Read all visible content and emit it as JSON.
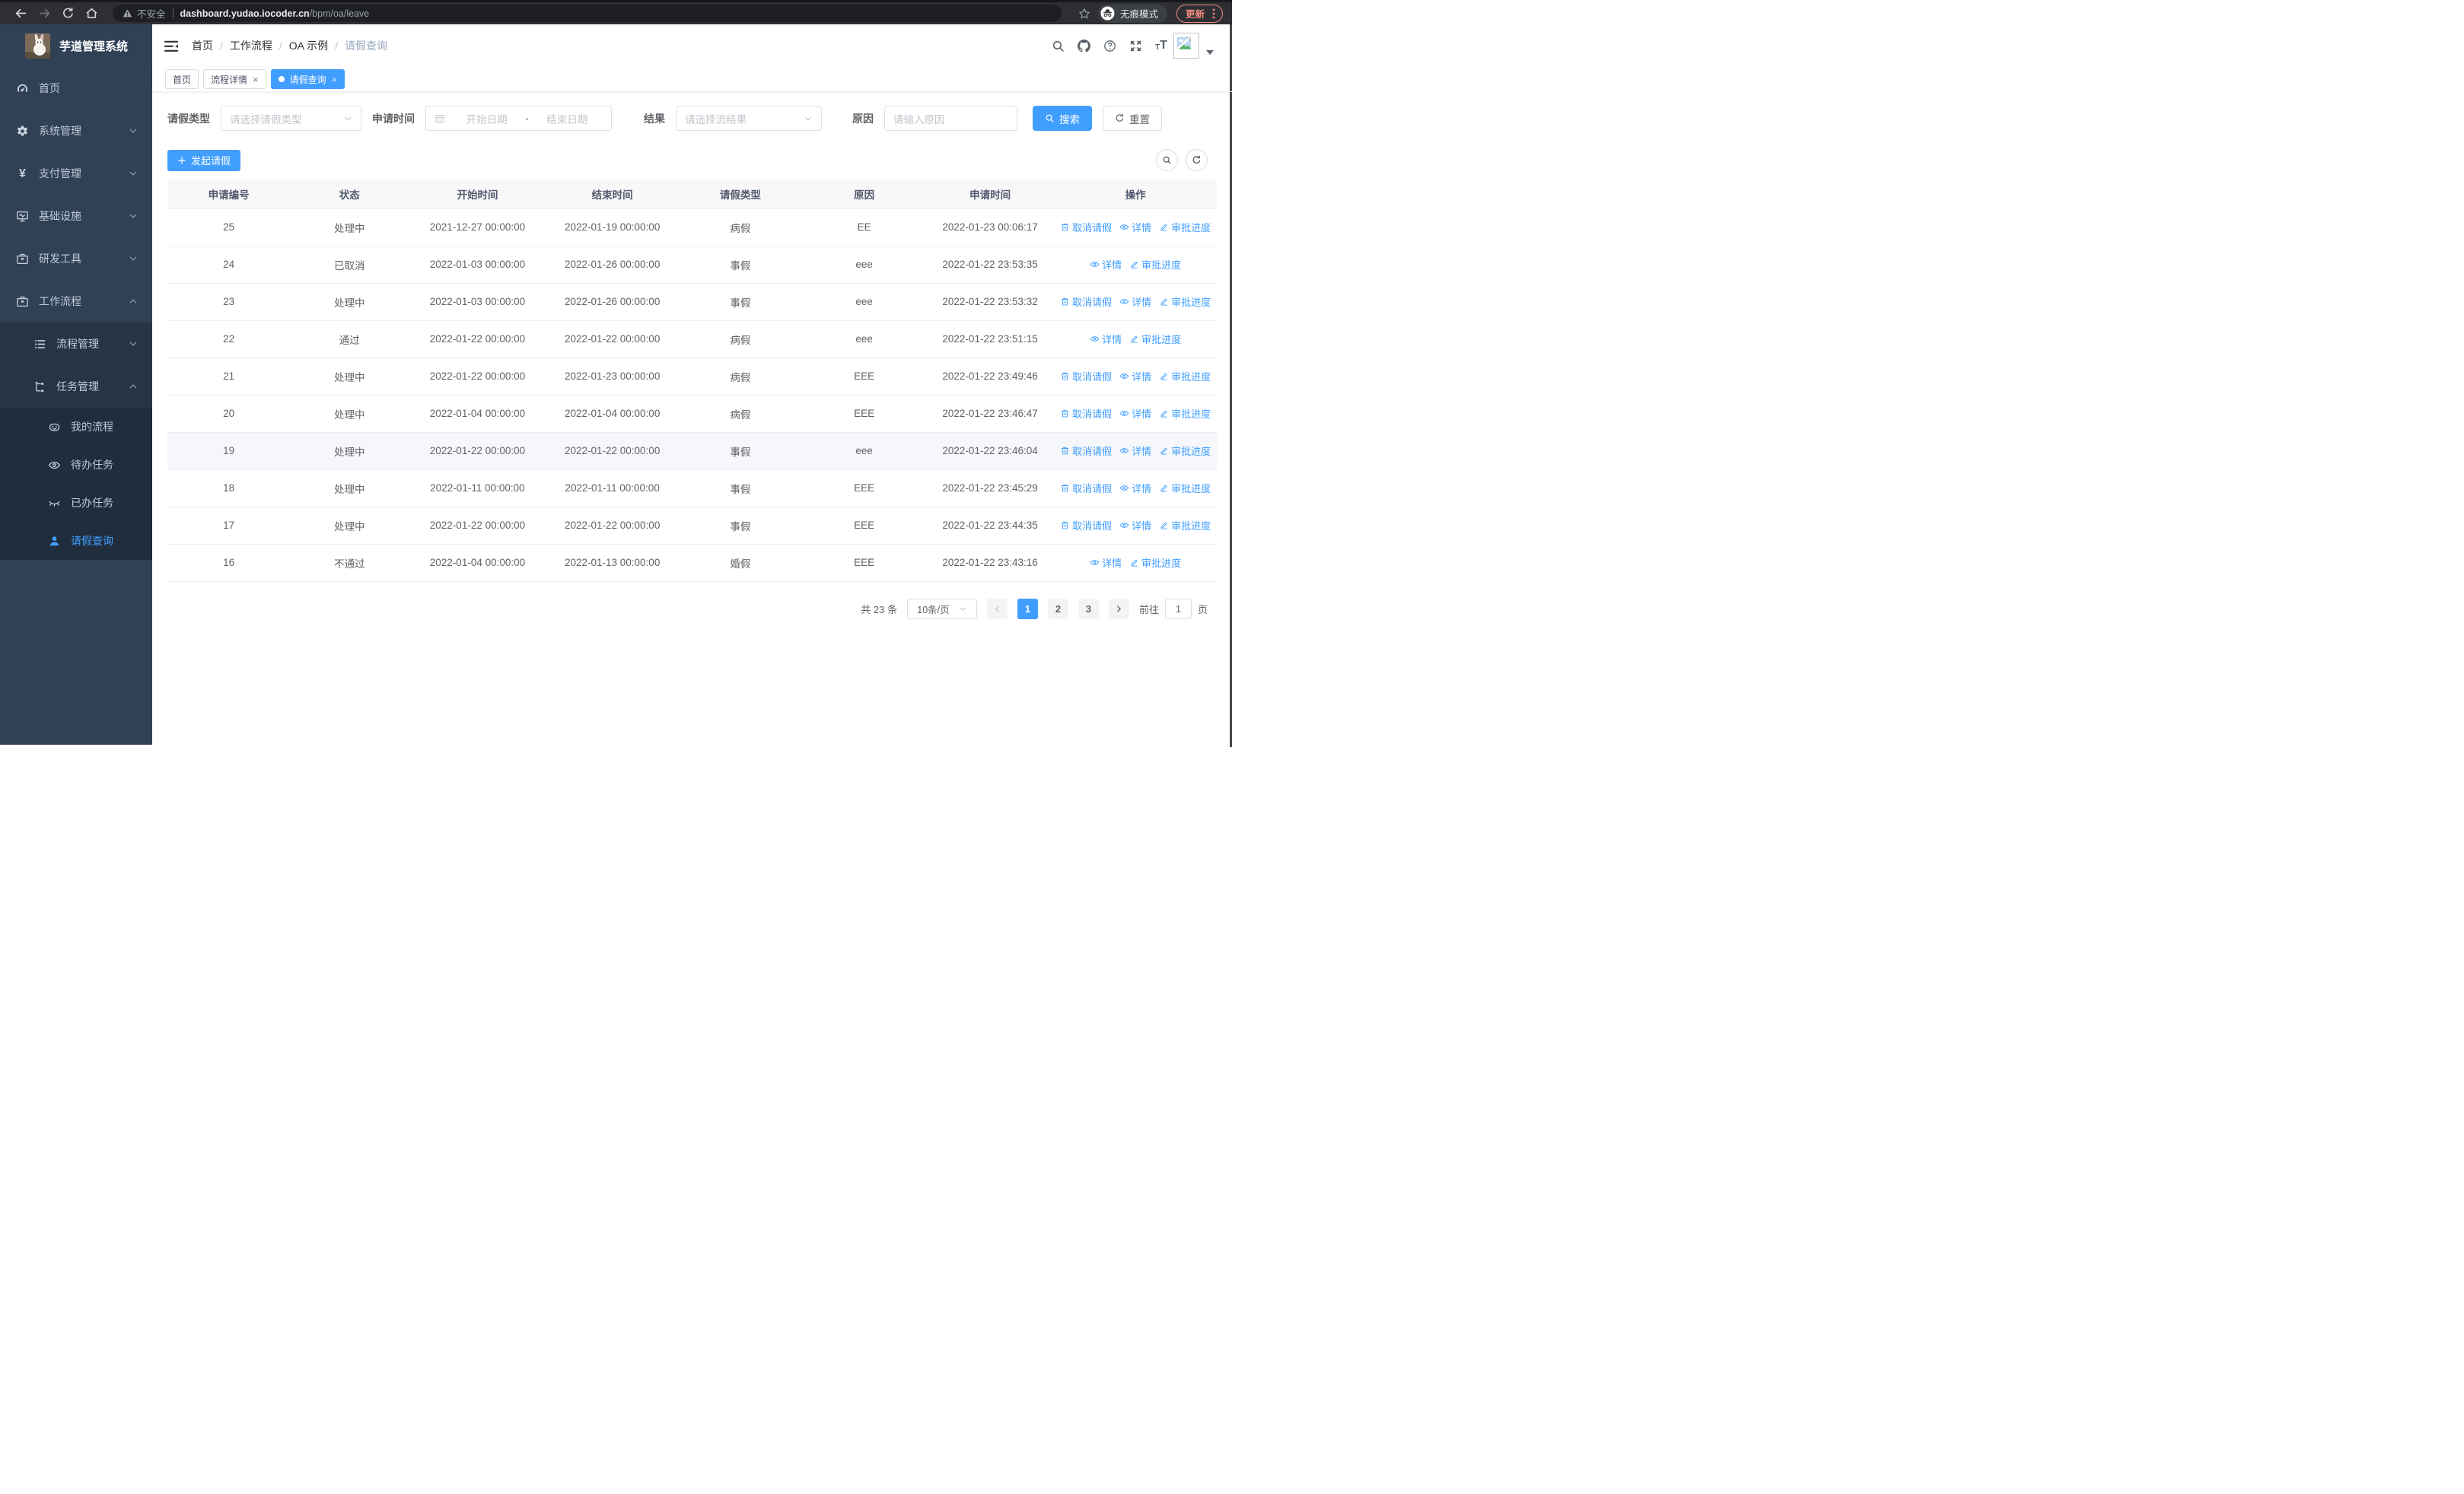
{
  "colors": {
    "primary": "#409eff",
    "sidebar_bg": "#304156",
    "sidebar_sub_bg": "#263445",
    "sidebar_leaf_bg": "#1f2d3d",
    "sidebar_text": "#bfcbd9",
    "update_accent": "#ef8a80"
  },
  "browser": {
    "security_label": "不安全",
    "url_host": "dashboard.yudao.iocoder.cn",
    "url_path": "/bpm/oa/leave",
    "incognito_label": "无痕模式",
    "update_label": "更新"
  },
  "sidebar": {
    "title": "芋道管理系统",
    "items": [
      {
        "key": "home",
        "label": "首页",
        "icon": "dashboard-icon",
        "level": 1
      },
      {
        "key": "system",
        "label": "系统管理",
        "icon": "gear-icon",
        "level": 1,
        "chevron": "down"
      },
      {
        "key": "payment",
        "label": "支付管理",
        "icon": "yen-icon",
        "level": 1,
        "chevron": "down"
      },
      {
        "key": "infra",
        "label": "基础设施",
        "icon": "monitor-icon",
        "level": 1,
        "chevron": "down"
      },
      {
        "key": "devtools",
        "label": "研发工具",
        "icon": "briefcase-icon",
        "level": 1,
        "chevron": "down"
      },
      {
        "key": "workflow",
        "label": "工作流程",
        "icon": "briefcase-icon",
        "level": 1,
        "chevron": "up"
      },
      {
        "key": "process-mgmt",
        "label": "流程管理",
        "icon": "list-icon",
        "level": 2,
        "chevron": "down"
      },
      {
        "key": "task-mgmt",
        "label": "任务管理",
        "icon": "tree-icon",
        "level": 2,
        "chevron": "up"
      },
      {
        "key": "my-process",
        "label": "我的流程",
        "icon": "robot-icon",
        "level": 3
      },
      {
        "key": "todo-tasks",
        "label": "待办任务",
        "icon": "eye-icon",
        "level": 3
      },
      {
        "key": "done-tasks",
        "label": "已办任务",
        "icon": "eye-closed-icon",
        "level": 3
      },
      {
        "key": "leave-query",
        "label": "请假查询",
        "icon": "user-icon",
        "level": 3,
        "active": true
      }
    ]
  },
  "breadcrumb": {
    "items": [
      {
        "label": "首页"
      },
      {
        "label": "工作流程"
      },
      {
        "label": "OA 示例"
      },
      {
        "label": "请假查询",
        "current": true
      }
    ]
  },
  "header_icons": [
    "search-icon",
    "github-icon",
    "question-icon",
    "fullscreen-icon",
    "font-size-icon"
  ],
  "tabs": [
    {
      "key": "home",
      "label": "首页"
    },
    {
      "key": "process-detail",
      "label": "流程详情",
      "closable": true
    },
    {
      "key": "leave-query",
      "label": "请假查询",
      "closable": true,
      "active": true
    }
  ],
  "filters": {
    "leave_type_label": "请假类型",
    "leave_type_placeholder": "请选择请假类型",
    "apply_time_label": "申请时间",
    "start_date_placeholder": "开始日期",
    "date_separator": "-",
    "end_date_placeholder": "结束日期",
    "result_label": "结果",
    "result_placeholder": "请选择流结果",
    "reason_label": "原因",
    "reason_placeholder": "请输入原因",
    "search_label": "搜索",
    "reset_label": "重置"
  },
  "toolbar": {
    "create_label": "发起请假"
  },
  "table": {
    "columns": [
      "申请编号",
      "状态",
      "开始时间",
      "结束时间",
      "请假类型",
      "原因",
      "申请时间",
      "操作"
    ],
    "col_widths": [
      "11.7%",
      "11.3%",
      "13.1%",
      "12.6%",
      "11.8%",
      "11.8%",
      "12.2%",
      "15.5%"
    ],
    "action_labels": {
      "cancel": "取消请假",
      "detail": "详情",
      "progress": "审批进度"
    },
    "action_icons": {
      "cancel": "delete-icon",
      "detail": "view-icon",
      "progress": "edit-icon"
    },
    "rows": [
      {
        "id": "25",
        "status": "处理中",
        "start": "2021-12-27 00:00:00",
        "end": "2022-01-19 00:00:00",
        "type": "病假",
        "reason": "EE",
        "apply_time": "2022-01-23 00:06:17",
        "actions": [
          "cancel",
          "detail",
          "progress"
        ]
      },
      {
        "id": "24",
        "status": "已取消",
        "start": "2022-01-03 00:00:00",
        "end": "2022-01-26 00:00:00",
        "type": "事假",
        "reason": "eee",
        "apply_time": "2022-01-22 23:53:35",
        "actions": [
          "detail",
          "progress"
        ]
      },
      {
        "id": "23",
        "status": "处理中",
        "start": "2022-01-03 00:00:00",
        "end": "2022-01-26 00:00:00",
        "type": "事假",
        "reason": "eee",
        "apply_time": "2022-01-22 23:53:32",
        "actions": [
          "cancel",
          "detail",
          "progress"
        ]
      },
      {
        "id": "22",
        "status": "通过",
        "start": "2022-01-22 00:00:00",
        "end": "2022-01-22 00:00:00",
        "type": "病假",
        "reason": "eee",
        "apply_time": "2022-01-22 23:51:15",
        "actions": [
          "detail",
          "progress"
        ]
      },
      {
        "id": "21",
        "status": "处理中",
        "start": "2022-01-22 00:00:00",
        "end": "2022-01-23 00:00:00",
        "type": "病假",
        "reason": "EEE",
        "apply_time": "2022-01-22 23:49:46",
        "actions": [
          "cancel",
          "detail",
          "progress"
        ]
      },
      {
        "id": "20",
        "status": "处理中",
        "start": "2022-01-04 00:00:00",
        "end": "2022-01-04 00:00:00",
        "type": "病假",
        "reason": "EEE",
        "apply_time": "2022-01-22 23:46:47",
        "actions": [
          "cancel",
          "detail",
          "progress"
        ]
      },
      {
        "id": "19",
        "status": "处理中",
        "start": "2022-01-22 00:00:00",
        "end": "2022-01-22 00:00:00",
        "type": "事假",
        "reason": "eee",
        "apply_time": "2022-01-22 23:46:04",
        "actions": [
          "cancel",
          "detail",
          "progress"
        ],
        "highlight": true
      },
      {
        "id": "18",
        "status": "处理中",
        "start": "2022-01-11 00:00:00",
        "end": "2022-01-11 00:00:00",
        "type": "事假",
        "reason": "EEE",
        "apply_time": "2022-01-22 23:45:29",
        "actions": [
          "cancel",
          "detail",
          "progress"
        ]
      },
      {
        "id": "17",
        "status": "处理中",
        "start": "2022-01-22 00:00:00",
        "end": "2022-01-22 00:00:00",
        "type": "事假",
        "reason": "EEE",
        "apply_time": "2022-01-22 23:44:35",
        "actions": [
          "cancel",
          "detail",
          "progress"
        ]
      },
      {
        "id": "16",
        "status": "不通过",
        "start": "2022-01-04 00:00:00",
        "end": "2022-01-13 00:00:00",
        "type": "婚假",
        "reason": "EEE",
        "apply_time": "2022-01-22 23:43:16",
        "actions": [
          "detail",
          "progress"
        ]
      }
    ]
  },
  "pagination": {
    "total_label": "共 23 条",
    "page_size": "10条/页",
    "pages": [
      "1",
      "2",
      "3"
    ],
    "active_page": "1",
    "goto_label": "前往",
    "goto_value": "1",
    "page_suffix": "页"
  }
}
